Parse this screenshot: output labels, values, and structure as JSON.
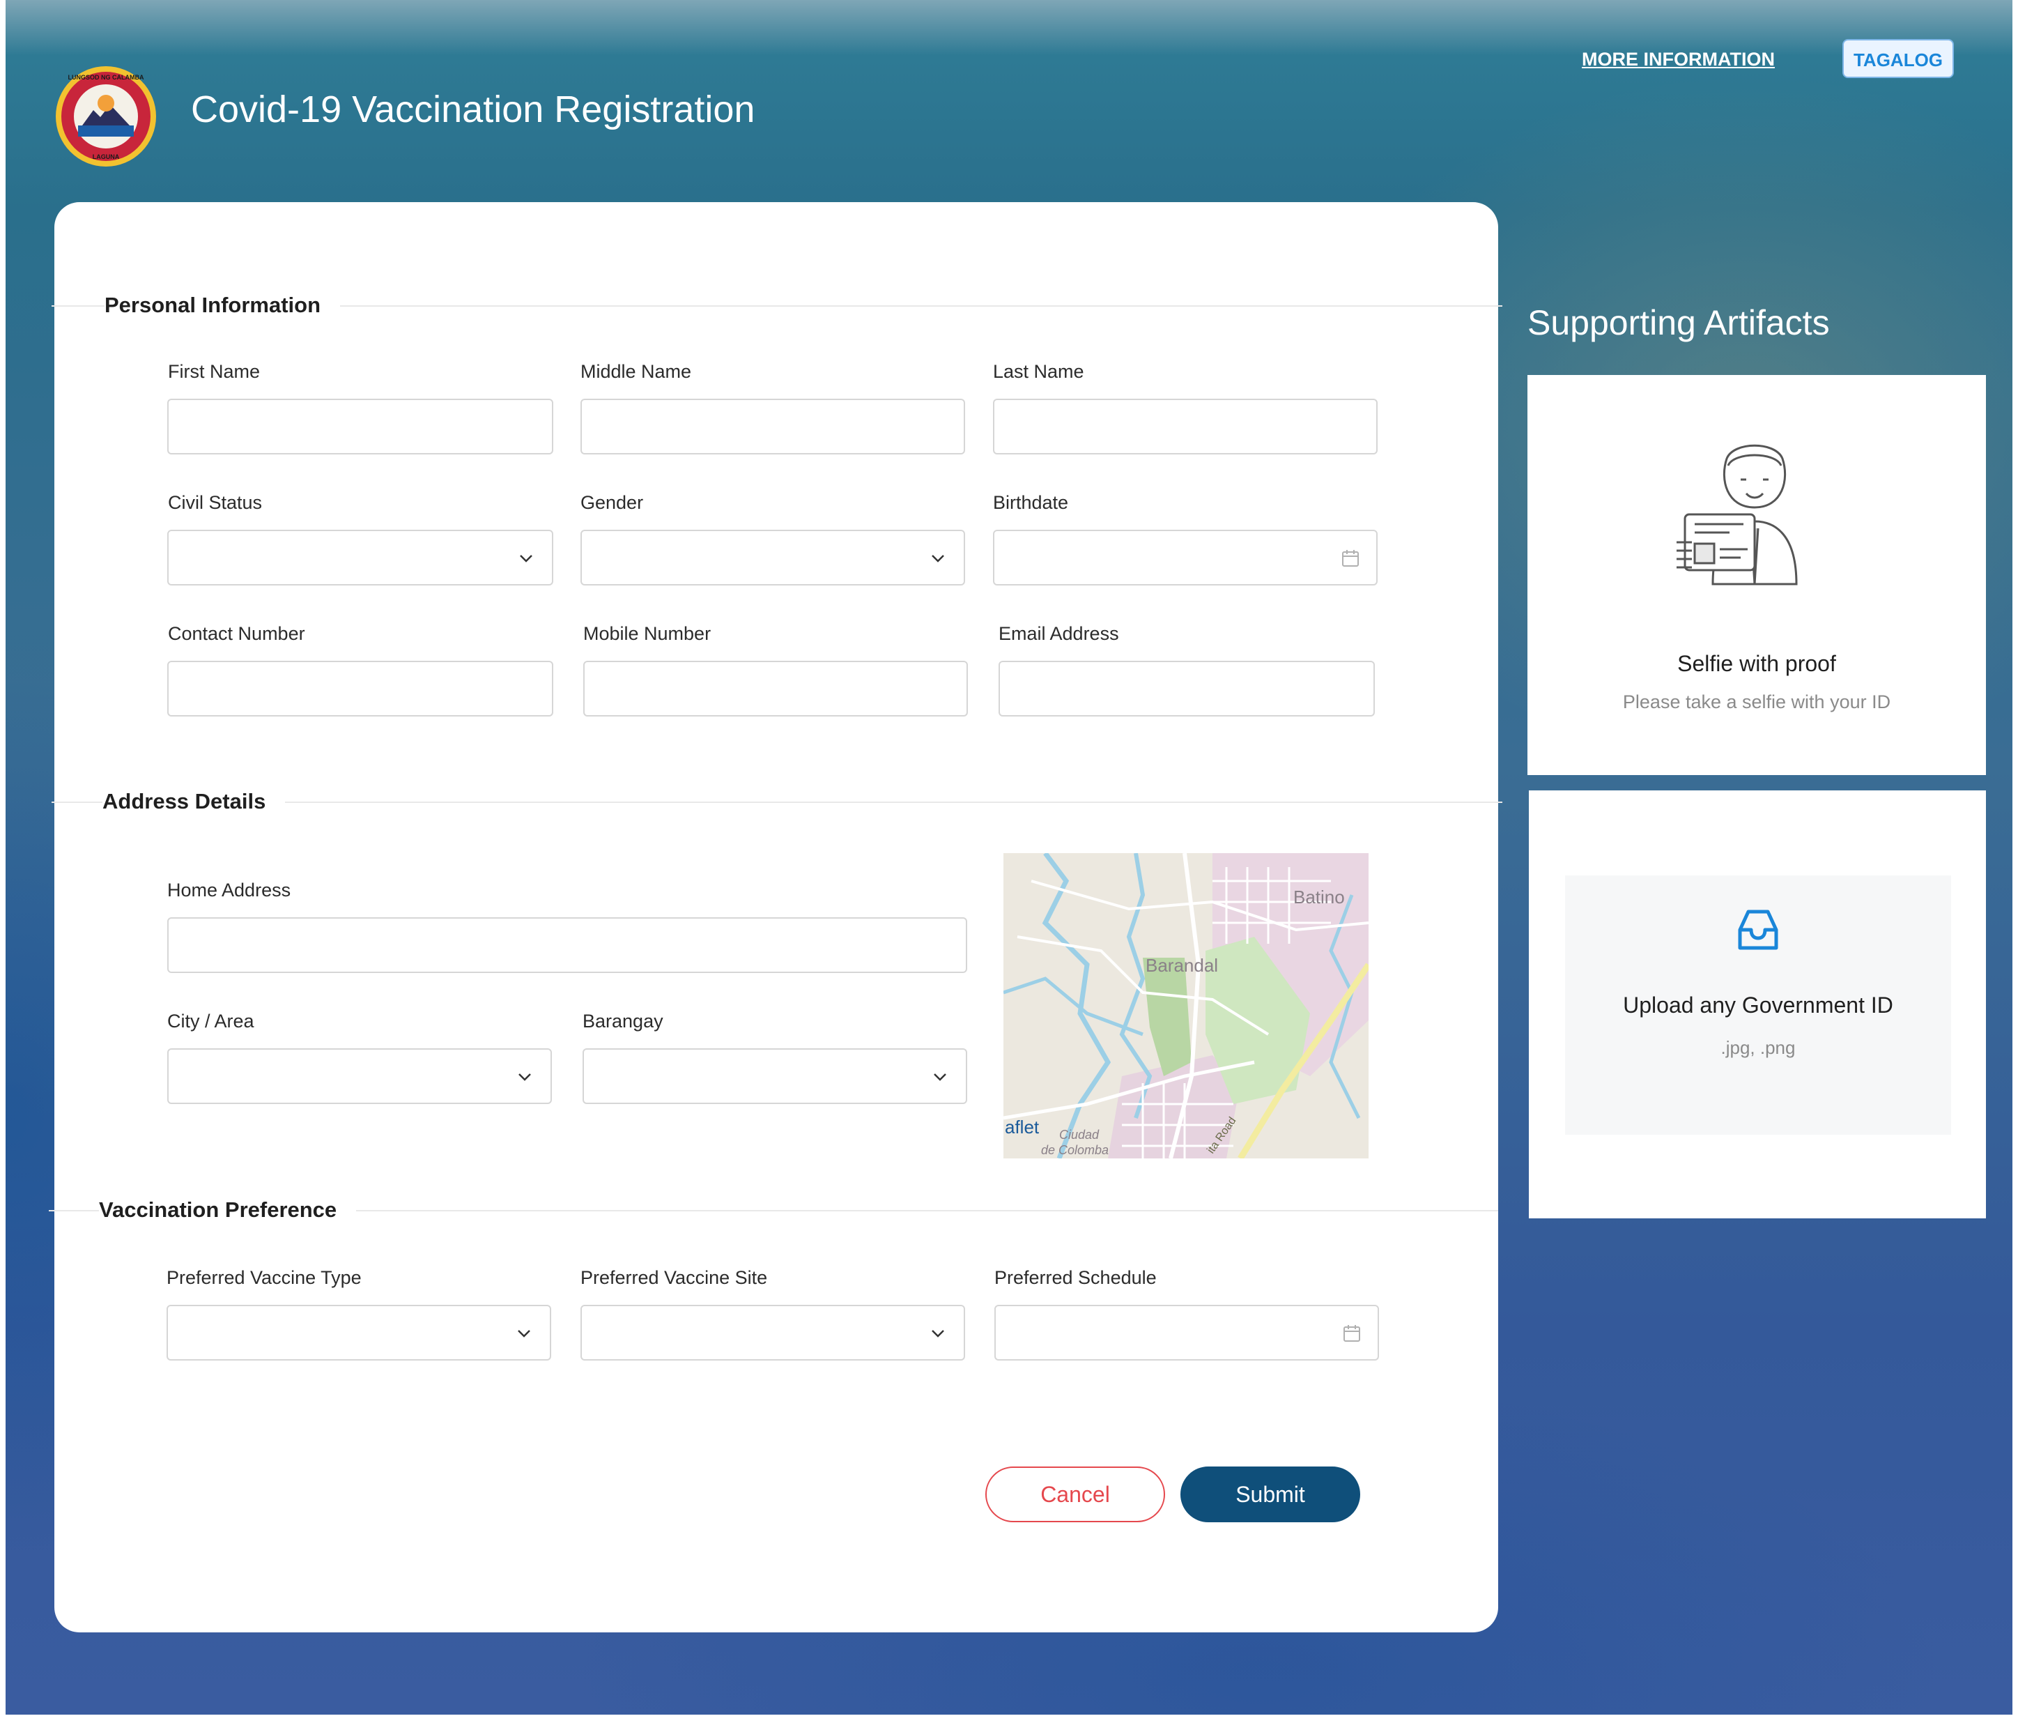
{
  "header": {
    "title": "Covid-19 Vaccination Registration",
    "more_info_label": "MORE INFORMATION",
    "language_button_label": "TAGALOG",
    "logo_text": "LUNGSOD NG CALAMBA · LAGUNA"
  },
  "personal_information": {
    "title": "Personal Information",
    "first_name_label": "First Name",
    "middle_name_label": "Middle Name",
    "last_name_label": "Last Name",
    "civil_status_label": "Civil Status",
    "gender_label": "Gender",
    "birthdate_label": "Birthdate",
    "contact_number_label": "Contact Number",
    "mobile_number_label": "Mobile Number",
    "email_address_label": "Email Address"
  },
  "address_details": {
    "title": "Address Details",
    "home_address_label": "Home Address",
    "city_area_label": "City / Area",
    "barangay_label": "Barangay",
    "map_labels": {
      "batino": "Batino",
      "barandal": "Barandal",
      "attribution": "aflet",
      "ciudad": "Ciudad",
      "de_colomba": "de Colomba",
      "road": "ita Road"
    }
  },
  "vaccination_preference": {
    "title": "Vaccination Preference",
    "vaccine_type_label": "Preferred Vaccine Type",
    "vaccine_site_label": "Preferred Vaccine Site",
    "schedule_label": "Preferred Schedule"
  },
  "actions": {
    "cancel_label": "Cancel",
    "submit_label": "Submit"
  },
  "supporting_artifacts": {
    "title": "Supporting Artifacts",
    "selfie": {
      "title": "Selfie with proof",
      "subtitle": "Please take a selfie with your ID",
      "icon": "person-with-id-icon"
    },
    "upload": {
      "title": "Upload any Government ID",
      "subtitle": ".jpg, .png",
      "icon": "inbox-icon"
    }
  },
  "colors": {
    "accent": "#1a86d9",
    "submit": "#0f4f7a",
    "cancel": "#e5484d"
  }
}
